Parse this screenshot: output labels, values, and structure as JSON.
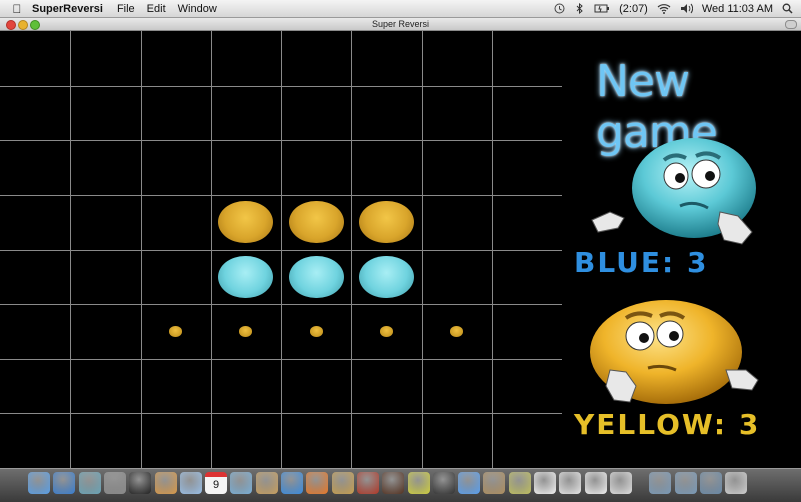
{
  "menubar": {
    "app_name": "SuperReversi",
    "items": [
      "File",
      "Edit",
      "Window"
    ],
    "battery": "(2:07)",
    "clock": "Wed 11:03 AM"
  },
  "window": {
    "title": "Super Reversi"
  },
  "board": {
    "rows": 8,
    "cols": 8,
    "pieces": [
      {
        "row": 3,
        "col": 3,
        "color": "yellow"
      },
      {
        "row": 3,
        "col": 4,
        "color": "yellow"
      },
      {
        "row": 3,
        "col": 5,
        "color": "yellow"
      },
      {
        "row": 4,
        "col": 3,
        "color": "blue"
      },
      {
        "row": 4,
        "col": 4,
        "color": "blue"
      },
      {
        "row": 4,
        "col": 5,
        "color": "blue"
      }
    ],
    "hints": [
      {
        "row": 5,
        "col": 2
      },
      {
        "row": 5,
        "col": 3
      },
      {
        "row": 5,
        "col": 4
      },
      {
        "row": 5,
        "col": 5
      },
      {
        "row": 5,
        "col": 6
      }
    ]
  },
  "panel": {
    "new_game_label": "New game",
    "blue_label": "BLUE:",
    "blue_score": "3",
    "yellow_label": "YELLOW:",
    "yellow_score": "3"
  },
  "colors": {
    "blue_piece": "#6fd3df",
    "yellow_piece": "#d9a52b",
    "grid": "#8a8a8a",
    "blue_text": "#2f8fe0",
    "yellow_text": "#e6bf28"
  },
  "dock": {
    "icons": [
      "finder-icon",
      "app-store-icon",
      "time-machine-icon",
      "system-prefs-icon",
      "dashboard-icon",
      "photos-icon",
      "facetime-icon",
      "calendar-icon",
      "preview-icon",
      "address-book-icon",
      "safari-icon",
      "firefox-icon",
      "iphoto-icon",
      "photo-booth-icon",
      "movie-icon",
      "star-icon",
      "dvd-icon",
      "itunes-icon",
      "garageband-icon",
      "spiral-icon",
      "text-edit-icon",
      "document-icon",
      "pages-icon",
      "notes-icon",
      "folder-icon",
      "applications-folder-icon",
      "downloads-icon",
      "trash-icon"
    ],
    "calendar_day": "9"
  }
}
